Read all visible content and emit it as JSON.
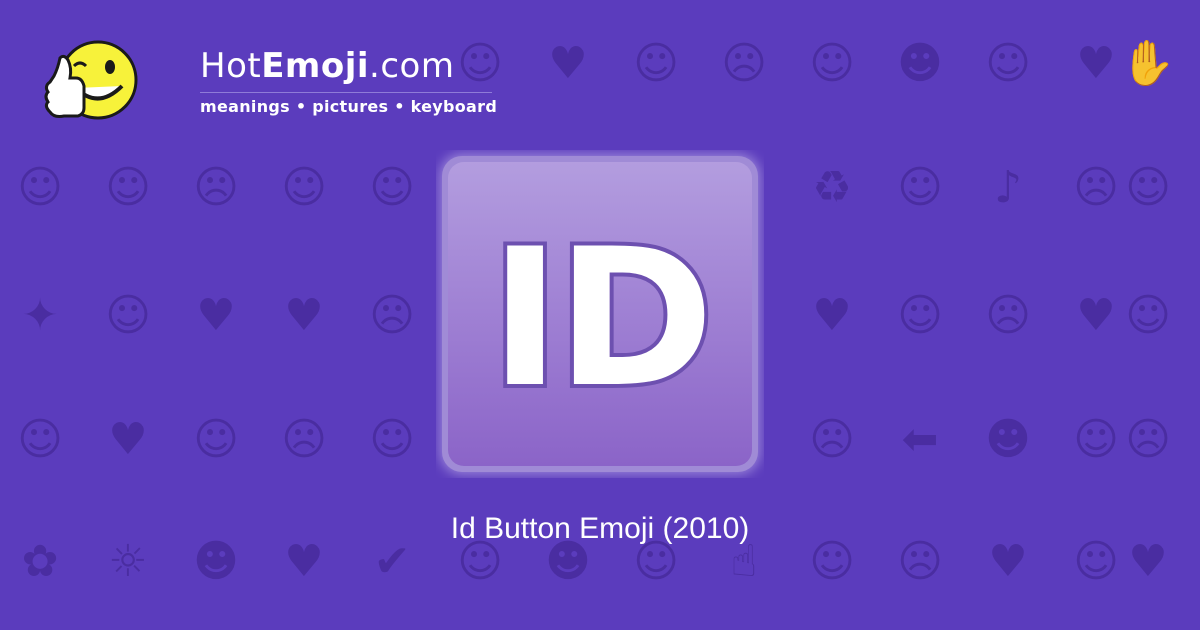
{
  "site": {
    "name_regular": "Hot",
    "name_bold": "Emoji",
    "name_suffix": ".com",
    "tagline": "meanings • pictures • keyboard"
  },
  "emoji": {
    "label": "ID",
    "caption": "Id Button Emoji (2010)"
  },
  "background_icons": [
    "☺",
    "♥",
    "☺",
    "☹",
    "☺",
    "☻",
    "☺",
    "♥",
    "✋",
    "☺",
    "☺",
    "☹",
    "☺",
    "☺",
    "♻",
    "☺",
    "♪",
    "☹",
    "☺",
    "✦",
    "☺",
    "♥",
    "♥",
    "☹",
    "♥",
    "☺",
    "☹",
    "♥",
    "☺",
    "☺",
    "♥",
    "☺",
    "☹",
    "☺",
    "☹",
    "⬅",
    "☻",
    "☺",
    "☹",
    "✿",
    "☼",
    "☻",
    "♥",
    "✔",
    "☺",
    "☻",
    "☺",
    "☝",
    "☺",
    "☹",
    "♥",
    "☺",
    "♥",
    "☺"
  ],
  "colors": {
    "background": "#5b3cbd",
    "pattern": "#4a2da0",
    "button_fill_top": "#b39ddf",
    "button_fill_bottom": "#8b64c8",
    "letter_fill": "#ffffff",
    "letter_stroke": "#6d50b0"
  }
}
